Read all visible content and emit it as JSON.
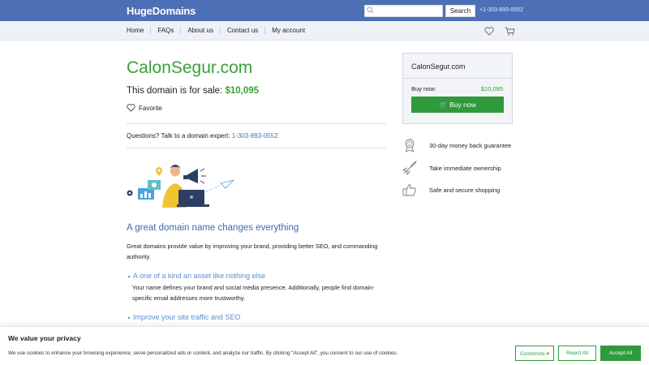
{
  "header": {
    "logo": "HugeDomains",
    "search_placeholder": "",
    "search_button": "Search",
    "phone": "+1-303-893-0552"
  },
  "nav": {
    "items": [
      "Home",
      "FAQs",
      "About us",
      "Contact us",
      "My account"
    ],
    "icons": [
      "heart-icon",
      "cart-icon"
    ]
  },
  "main": {
    "domain": "CalonSegur.com",
    "sale_prefix": "This domain is for sale: ",
    "price": "$10,095",
    "favorite_label": "Favorite",
    "questions_prefix": "Questions? Talk to a domain expert: ",
    "questions_phone": "1-303-893-0552",
    "headline": "A great domain name changes everything",
    "description": "Great domains provide value by improving your brand, providing better SEO, and commanding authority.",
    "bullets": [
      {
        "title": "A one of a kind an asset like nothing else",
        "text": "Your name defines your brand and social media presence. Additionally, people find domain-specific email addresses more trustworthy."
      },
      {
        "title": "Improve your site traffic and SEO",
        "text": ""
      }
    ]
  },
  "sidebar": {
    "domain": "CalonSegur.com",
    "buy_now_label": "Buy now:",
    "buy_now_price": "$10,095",
    "buy_button": "🛒 Buy now",
    "features": [
      {
        "icon": "medal-icon",
        "text": "30-day money back guarantee"
      },
      {
        "icon": "rocket-icon",
        "text": "Take immediate ownership"
      },
      {
        "icon": "thumbs-up-icon",
        "text": "Safe and secure shopping"
      }
    ]
  },
  "cookie": {
    "title": "We value your privacy",
    "text": "We use cookies to enhance your browsing experience, serve personalized ads or content, and analyze our traffic. By clicking \"Accept All\", you consent to our use of cookies.",
    "customize": "Customize ▾",
    "reject": "Reject All",
    "accept": "Accept All"
  },
  "colors": {
    "header_bg": "#4d6fb6",
    "brand_green": "#2f9a3c",
    "price_green": "#3aa03a",
    "link_blue": "#3a77c1"
  }
}
